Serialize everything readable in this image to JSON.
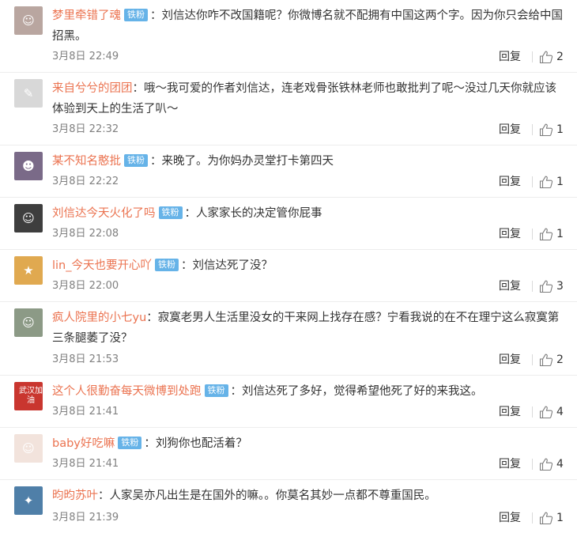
{
  "comments": [
    {
      "username": "梦里牵错了魂",
      "badge": "铁粉",
      "text": "：刘信达你咋不改国籍呢？你微博名就不配拥有中国这两个字。因为你只会给中国招黑。",
      "time": "3月8日 22:49",
      "reply_label": "回复",
      "likes": "2",
      "avatar": {
        "icon": "anime-avatar-icon",
        "glyph": "☺",
        "bg": "#b9a6a0"
      }
    },
    {
      "username": "来自兮兮的团团",
      "badge": "",
      "text": "：哦～我可爱的作者刘信达，连老戏骨张铁林老师也敢批判了呢～没过几天你就应该体验到天上的生活了叭～",
      "time": "3月8日 22:32",
      "reply_label": "回复",
      "likes": "1",
      "avatar": {
        "icon": "sketch-avatar-icon",
        "glyph": "✎",
        "bg": "#d8d8d8"
      }
    },
    {
      "username": "某不知名憨批",
      "badge": "铁粉",
      "text": "：来晚了。为你妈办灵堂打卡第四天",
      "time": "3月8日 22:22",
      "reply_label": "回复",
      "likes": "1",
      "avatar": {
        "icon": "anime-avatar-icon",
        "glyph": "☻",
        "bg": "#7a6a88"
      }
    },
    {
      "username": "刘信达今天火化了吗",
      "badge": "铁粉",
      "text": "：人家家长的决定管你屁事",
      "time": "3月8日 22:08",
      "reply_label": "回复",
      "likes": "1",
      "avatar": {
        "icon": "portrait-avatar-icon",
        "glyph": "☺",
        "bg": "#3e3e3e"
      }
    },
    {
      "username": "lin_今天也要开心吖",
      "badge": "铁粉",
      "text": "：刘信达死了没？",
      "time": "3月8日 22:00",
      "reply_label": "回复",
      "likes": "3",
      "avatar": {
        "icon": "anime-avatar-icon",
        "glyph": "★",
        "bg": "#e0a950"
      }
    },
    {
      "username": "疯人院里的小七yu",
      "badge": "",
      "text": "：寂寞老男人生活里没女的干来网上找存在感？宁看我说的在不在理宁这么寂寞第三条腿萎了没？",
      "time": "3月8日 21:53",
      "reply_label": "回复",
      "likes": "2",
      "avatar": {
        "icon": "photo-avatar-icon",
        "glyph": "☺",
        "bg": "#8c9a86"
      }
    },
    {
      "username": "这个人很勤奋每天微博到处跑",
      "badge": "铁粉",
      "text": "：刘信达死了多好，觉得希望他死了好的来我这。",
      "time": "3月8日 21:41",
      "reply_label": "回复",
      "likes": "4",
      "avatar": {
        "icon": "poster-avatar-icon",
        "glyph": "武汉加油",
        "bg": "#c9362f"
      }
    },
    {
      "username": "baby好吃嘛",
      "badge": "铁粉",
      "text": "：刘狗你也配活着？",
      "time": "3月8日 21:41",
      "reply_label": "回复",
      "likes": "4",
      "avatar": {
        "icon": "girl-avatar-icon",
        "glyph": "☺",
        "bg": "#f2e3dc"
      }
    },
    {
      "username": "昀昀苏叶",
      "badge": "",
      "text": "：人家吴亦凡出生是在国外的嘛。。你莫名其妙一点都不尊重国民。",
      "time": "3月8日 21:39",
      "reply_label": "回复",
      "likes": "1",
      "avatar": {
        "icon": "scene-avatar-icon",
        "glyph": "✦",
        "bg": "#4f7fa8"
      }
    }
  ]
}
